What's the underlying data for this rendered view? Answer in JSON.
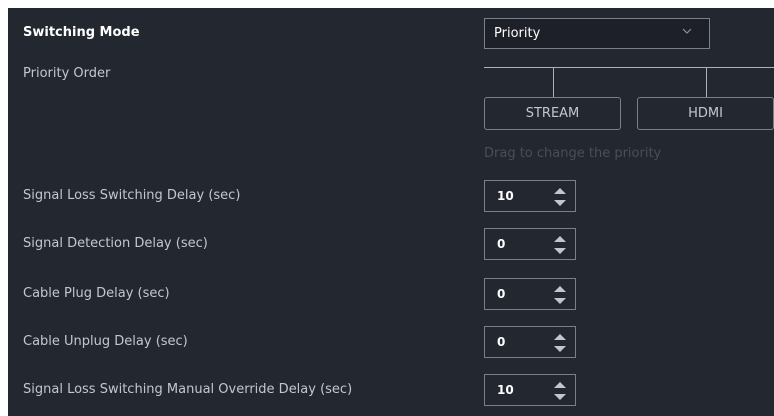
{
  "switching_mode": {
    "label": "Switching Mode",
    "selected": "Priority",
    "icon": "chevron-down-icon"
  },
  "priority_order": {
    "label": "Priority Order",
    "items": [
      "STREAM",
      "HDMI"
    ],
    "hint": "Drag to change the priority"
  },
  "delays": [
    {
      "label": "Signal Loss Switching Delay (sec)",
      "value": "10"
    },
    {
      "label": "Signal Detection Delay (sec)",
      "value": "0"
    },
    {
      "label": "Cable Plug Delay (sec)",
      "value": "0"
    },
    {
      "label": "Cable Unplug Delay (sec)",
      "value": "0"
    },
    {
      "label": "Signal Loss Switching Manual Override Delay (sec)",
      "value": "10"
    }
  ],
  "colors": {
    "background": "#232730",
    "border": "#7a7f88",
    "label_text": "#c3c7cd",
    "hint_text": "#4a4e57"
  }
}
